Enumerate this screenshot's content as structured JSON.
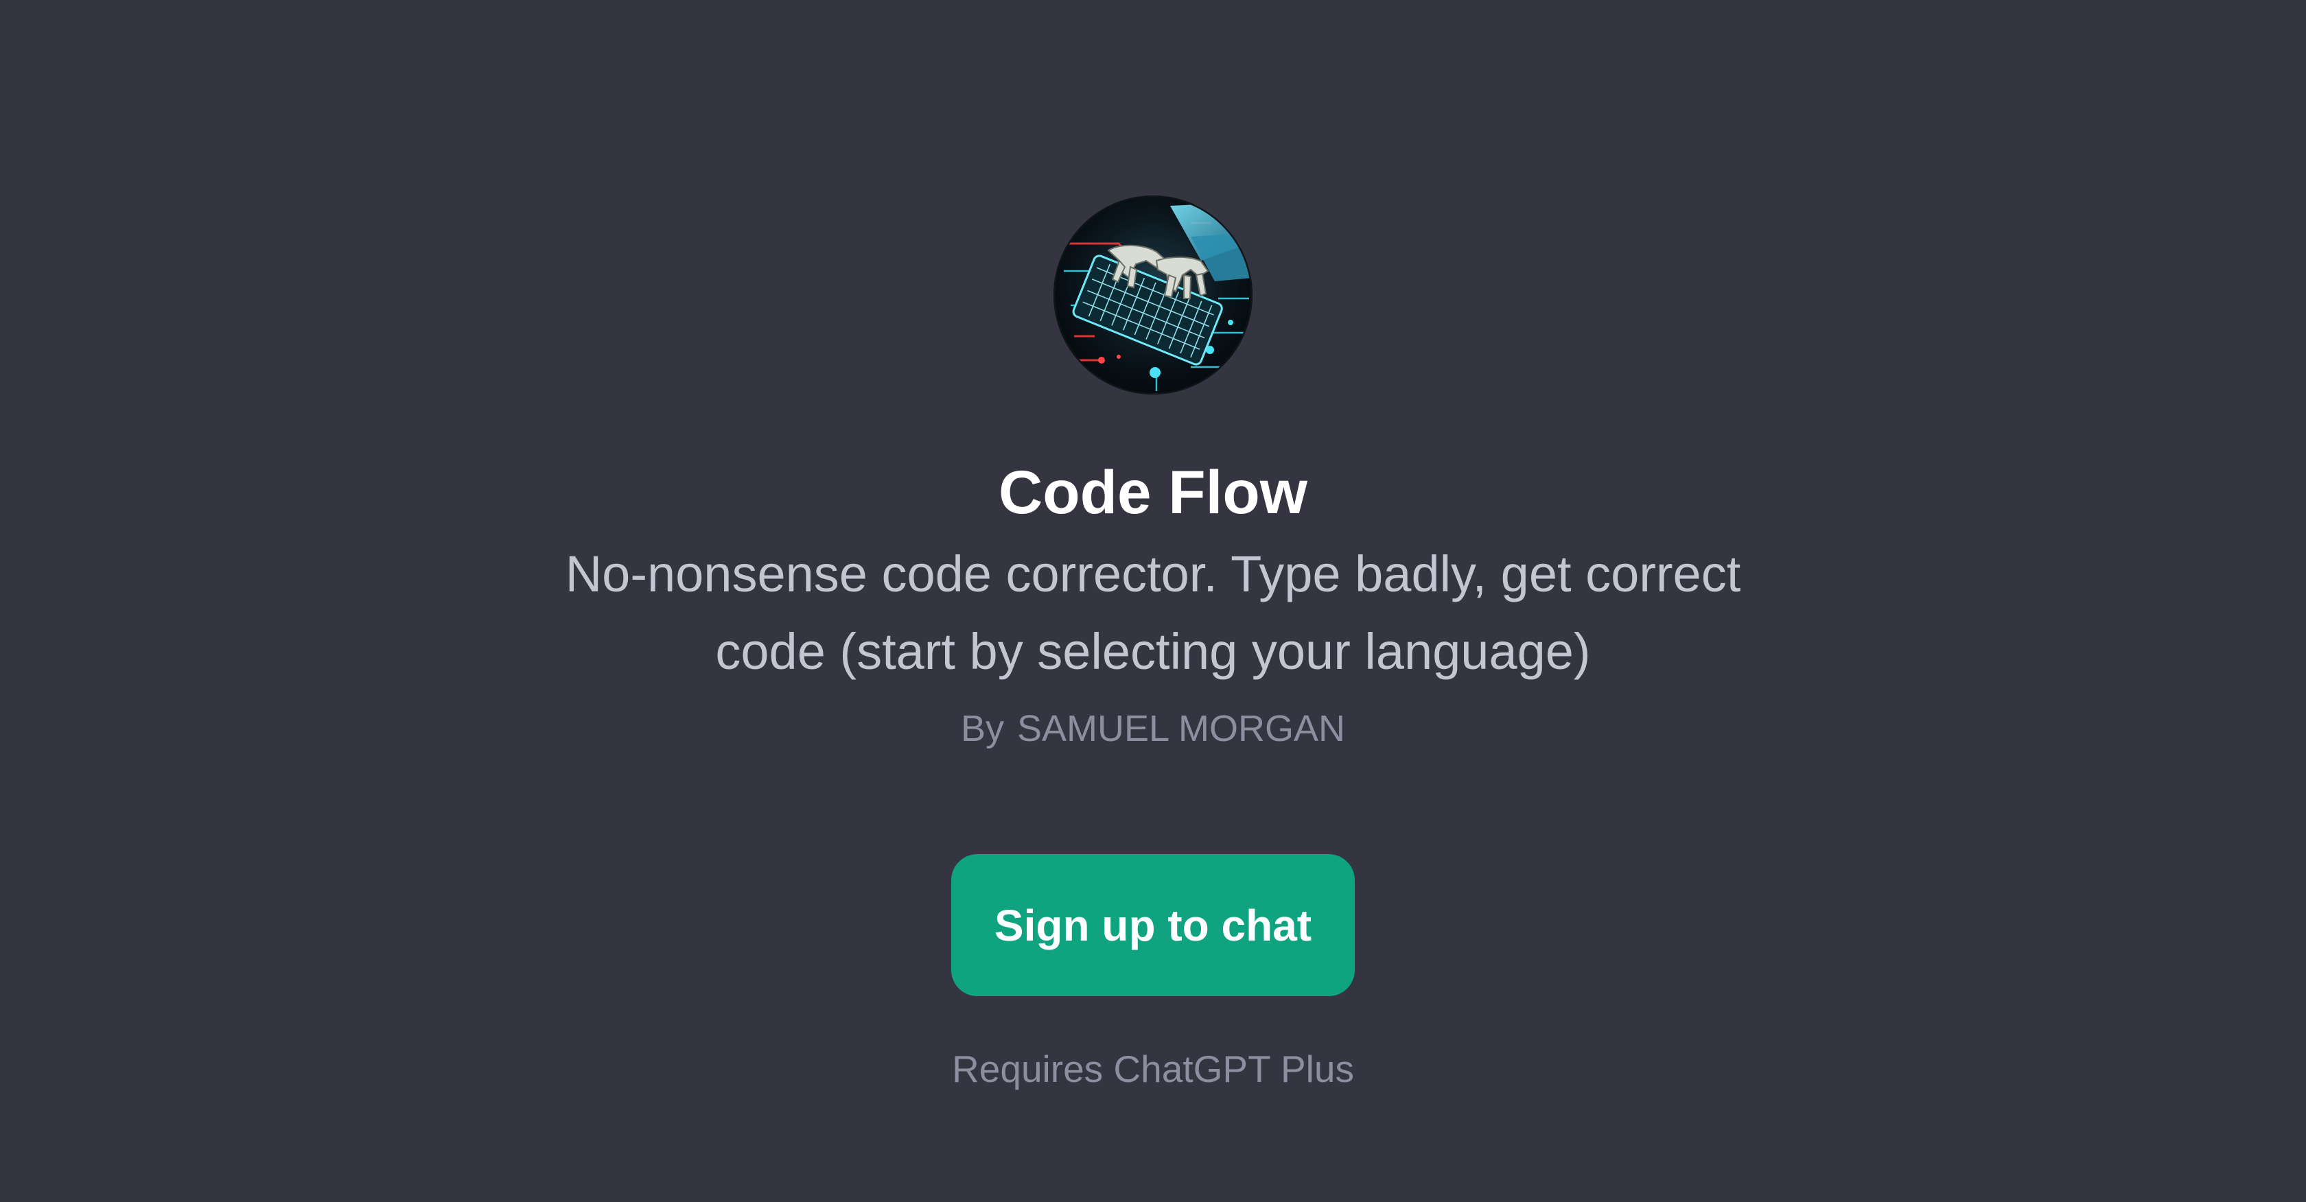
{
  "gpt": {
    "title": "Code Flow",
    "description": "No-nonsense code corrector. Type badly, get correct code (start by selecting your language)",
    "author_prefix": "By",
    "author_name": "SAMUEL MORGAN",
    "avatar_icon": "keyboard-hands-avatar-icon"
  },
  "actions": {
    "signup_label": "Sign up to chat"
  },
  "footer": {
    "requirement": "Requires ChatGPT Plus"
  },
  "colors": {
    "background": "#343541",
    "accent": "#10a37f",
    "title": "#ffffff",
    "description": "#c5c5d2",
    "muted": "#8e8ea0"
  }
}
